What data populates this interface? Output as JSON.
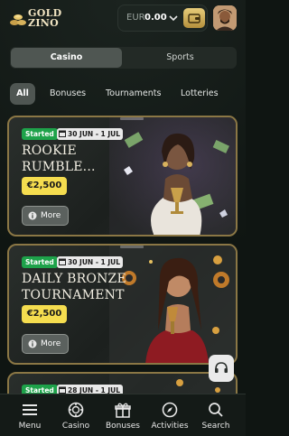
{
  "brand": {
    "line1": "GOLD",
    "line2": "ZINO"
  },
  "wallet": {
    "currency": "EUR",
    "amount": "0.00"
  },
  "main_toggle": [
    {
      "label": "Casino"
    },
    {
      "label": "Sports"
    }
  ],
  "filters": [
    {
      "label": "All"
    },
    {
      "label": "Bonuses"
    },
    {
      "label": "Tournaments"
    },
    {
      "label": "Lotteries"
    }
  ],
  "cards": [
    {
      "status": "Started",
      "dates": "30 JUN - 1 JUL",
      "title_line1": "ROOKIE",
      "title_line2": "RUMBLE...",
      "prize": "€2,500",
      "more": "More"
    },
    {
      "status": "Started",
      "dates": "30 JUN - 1 JUL",
      "title_line1": "DAILY BRONZE",
      "title_line2": "TOURNAMENT",
      "prize": "€2,500",
      "more": "More"
    },
    {
      "status": "Started",
      "dates": "28 JUN - 1 JUL"
    }
  ],
  "nav": [
    {
      "label": "Menu",
      "icon": "menu-icon"
    },
    {
      "label": "Casino",
      "icon": "casino-chip-icon"
    },
    {
      "label": "Bonuses",
      "icon": "gift-icon"
    },
    {
      "label": "Activities",
      "icon": "compass-icon"
    },
    {
      "label": "Search",
      "icon": "search-icon"
    }
  ],
  "colors": {
    "accent_gold": "#d4b15e",
    "started_green": "#1ea24a",
    "prize_yellow": "#f5dd4f",
    "background": "#0f1512"
  }
}
